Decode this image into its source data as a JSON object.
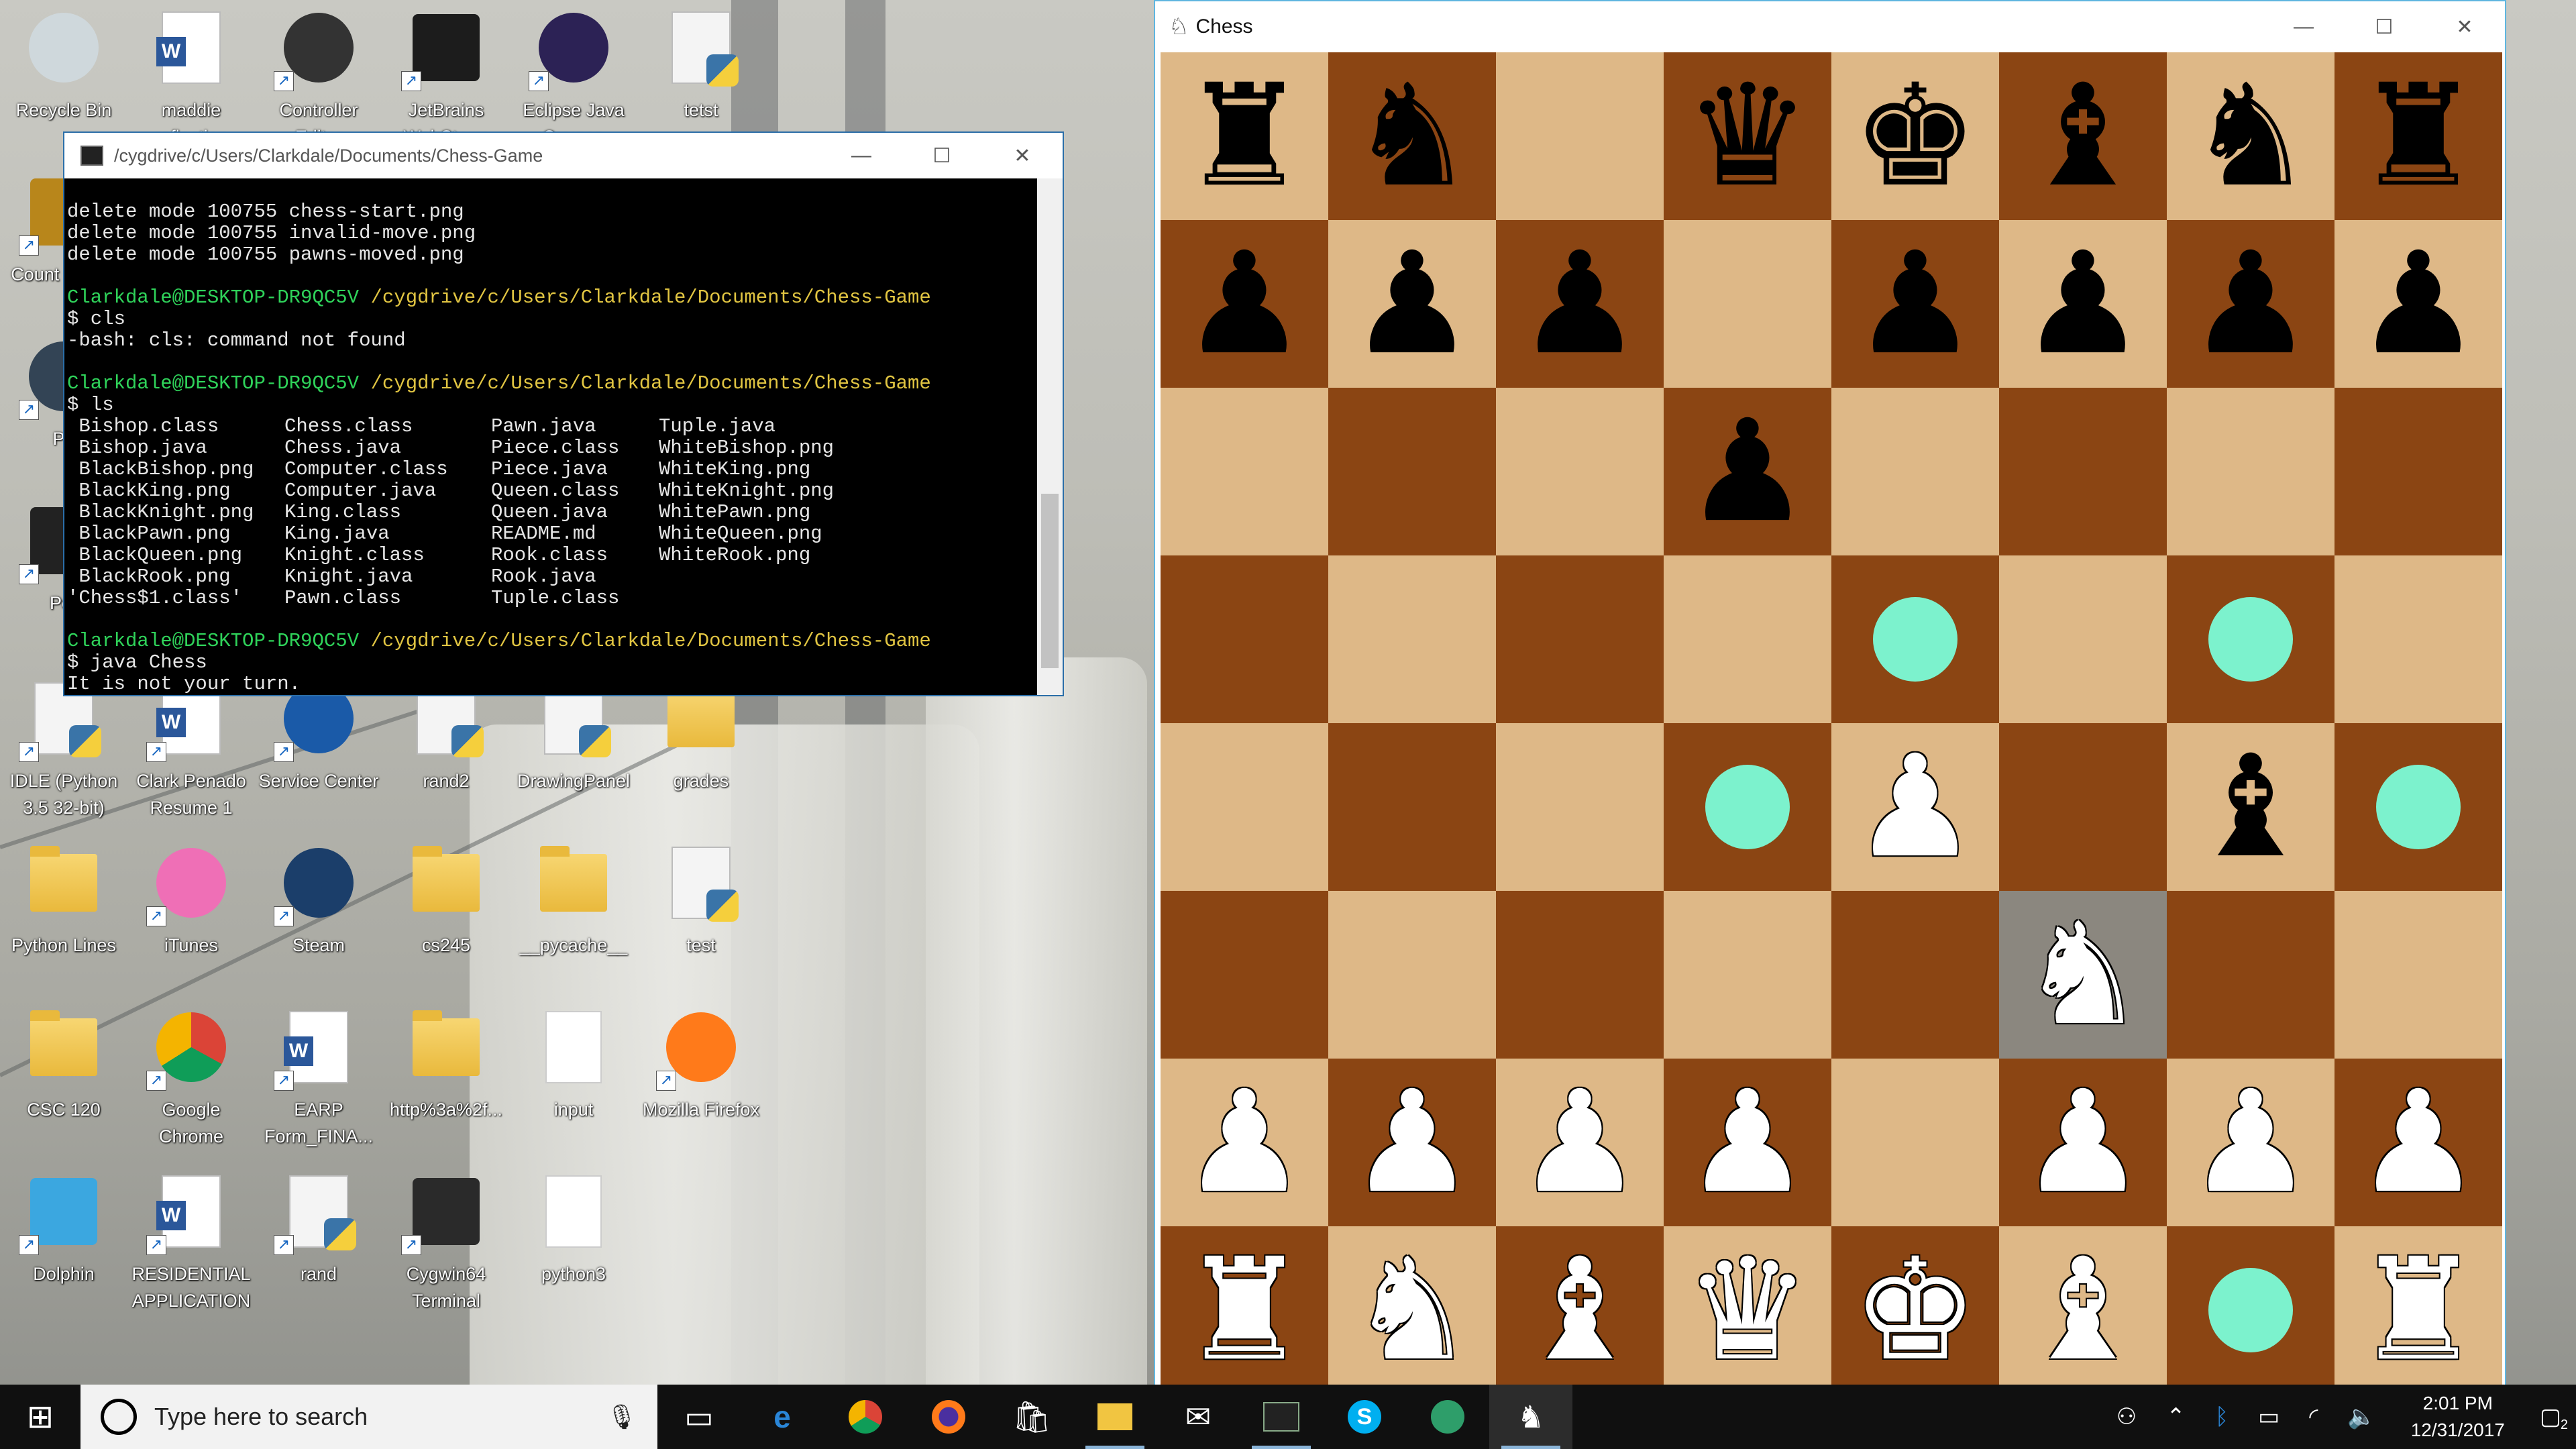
{
  "desktop": {
    "icons": [
      {
        "id": "recycle",
        "label": "Recycle Bin"
      },
      {
        "id": "maddie",
        "label": "maddie reflection"
      },
      {
        "id": "controller",
        "label": "Controller Editor"
      },
      {
        "id": "jetbrains",
        "label": "JetBrains WebStorm"
      },
      {
        "id": "eclipse",
        "label": "Eclipse Java Oxygen"
      },
      {
        "id": "tetst",
        "label": "tetst"
      },
      {
        "id": "counter",
        "label": "Count Global"
      },
      {
        "id": "po",
        "label": "Po"
      },
      {
        "id": "por",
        "label": "Por"
      },
      {
        "id": "idle",
        "label": "IDLE (Python 3.5 32-bit)"
      },
      {
        "id": "clarkresume",
        "label": "Clark Penado Resume 1"
      },
      {
        "id": "servicecenter",
        "label": "Service Center"
      },
      {
        "id": "rand2",
        "label": "rand2"
      },
      {
        "id": "drawingpanel",
        "label": "DrawingPanel"
      },
      {
        "id": "grades",
        "label": "grades"
      },
      {
        "id": "pythonlines",
        "label": "Python Lines"
      },
      {
        "id": "itunes",
        "label": "iTunes"
      },
      {
        "id": "steam",
        "label": "Steam"
      },
      {
        "id": "cs245",
        "label": "cs245"
      },
      {
        "id": "pycache",
        "label": "__pycache__"
      },
      {
        "id": "test",
        "label": "test"
      },
      {
        "id": "csc120",
        "label": "CSC 120"
      },
      {
        "id": "chrome",
        "label": "Google Chrome"
      },
      {
        "id": "earp",
        "label": "EARP Form_FINA..."
      },
      {
        "id": "http",
        "label": "http%3a%2f..."
      },
      {
        "id": "input",
        "label": "input"
      },
      {
        "id": "firefox",
        "label": "Mozilla Firefox"
      },
      {
        "id": "dolphin",
        "label": "Dolphin"
      },
      {
        "id": "residential",
        "label": "RESIDENTIAL APPLICATION"
      },
      {
        "id": "rand",
        "label": "rand"
      },
      {
        "id": "cygwin",
        "label": "Cygwin64 Terminal"
      },
      {
        "id": "python3",
        "label": "python3"
      }
    ]
  },
  "terminal": {
    "title": "/cygdrive/c/Users/Clarkdale/Documents/Chess-Game",
    "lines_top": [
      "delete mode 100755 chess-start.png",
      "delete mode 100755 invalid-move.png",
      "delete mode 100755 pawns-moved.png"
    ],
    "prompt_user": "Clarkdale@DESKTOP-DR9QC5V",
    "prompt_path": "/cygdrive/c/Users/Clarkdale/Documents/Chess-Game",
    "cmd1": "$ cls",
    "out1": "-bash: cls: command not found",
    "cmd2": "$ ls",
    "ls_col1": [
      " Bishop.class",
      " Bishop.java",
      " BlackBishop.png",
      " BlackKing.png",
      " BlackKnight.png",
      " BlackPawn.png",
      " BlackQueen.png",
      " BlackRook.png",
      "'Chess$1.class'"
    ],
    "ls_col2": [
      "Chess.class",
      "Chess.java",
      "Computer.class",
      "Computer.java",
      "King.class",
      "King.java",
      "Knight.class",
      "Knight.java",
      "Pawn.class"
    ],
    "ls_col3": [
      "Pawn.java",
      "Piece.class",
      "Piece.java",
      "Queen.class",
      "Queen.java",
      "README.md",
      "Rook.class",
      "Rook.java",
      "Tuple.class"
    ],
    "ls_col4": [
      "Tuple.java",
      "WhiteBishop.png",
      "WhiteKing.png",
      "WhiteKnight.png",
      "WhitePawn.png",
      "WhiteQueen.png",
      "WhiteRook.png",
      "",
      ""
    ],
    "cmd3": "$ java Chess",
    "out3": "It is not your turn."
  },
  "chess": {
    "title": "Chess",
    "board": [
      [
        "bR",
        "bN",
        "",
        "bQ",
        "bK",
        "bB",
        "bN",
        "bR"
      ],
      [
        "bP",
        "bP",
        "bP",
        "",
        "bP",
        "bP",
        "bP",
        "bP"
      ],
      [
        "",
        "",
        "",
        "bP",
        "",
        "",
        "",
        ""
      ],
      [
        "",
        "",
        "",
        "",
        "*",
        "",
        "*",
        ""
      ],
      [
        "",
        "",
        "",
        "*",
        "wP",
        "",
        "bB",
        "*"
      ],
      [
        "",
        "",
        "",
        "",
        "",
        "wN",
        "",
        ""
      ],
      [
        "wP",
        "wP",
        "wP",
        "wP",
        "",
        "wP",
        "wP",
        "wP"
      ],
      [
        "wR",
        "wN",
        "wB",
        "wQ",
        "wK",
        "wB",
        "*",
        "wR"
      ]
    ],
    "selected": [
      5,
      5
    ],
    "colors": {
      "light": "#deb887",
      "dark": "#8b4513",
      "highlight": "#7cf2cd",
      "selected": "#8b877f"
    }
  },
  "taskbar": {
    "search_placeholder": "Type here to search",
    "apps": [
      "task-view",
      "edge",
      "chrome",
      "firefox",
      "store",
      "file-explorer",
      "mail",
      "cygwin",
      "skype",
      "green-app",
      "chess-app"
    ],
    "time": "2:01 PM",
    "date": "12/31/2017",
    "notification_count": "2"
  }
}
